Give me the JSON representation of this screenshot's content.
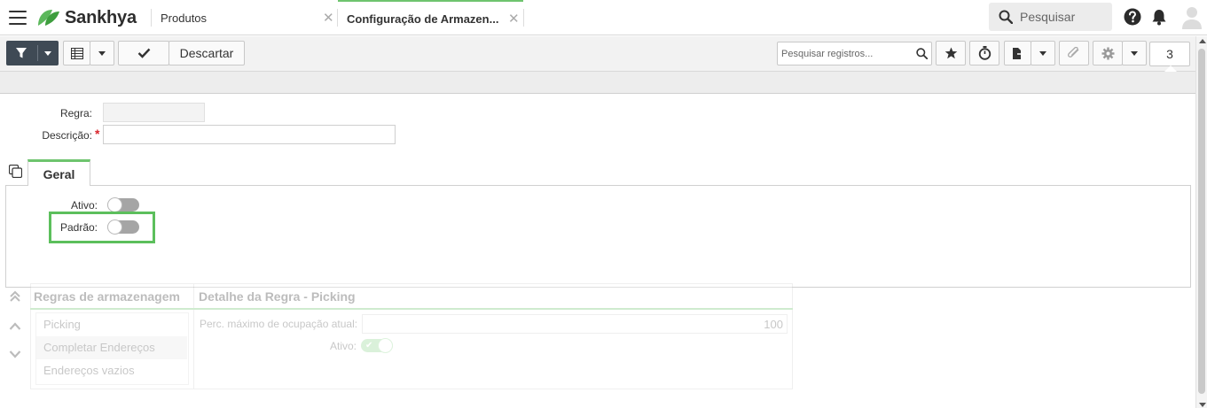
{
  "topbar": {
    "brand": "Sankhya",
    "tabs": [
      {
        "label": "Produtos",
        "close": "✕"
      },
      {
        "label": "Configuração de Armazen...",
        "close": "✕"
      }
    ],
    "search_label": "Pesquisar",
    "icons": [
      "menu-icon",
      "help-icon",
      "bell-icon",
      "user-avatar-icon"
    ]
  },
  "toolbar": {
    "discard_label": "Descartar",
    "search_placeholder": "Pesquisar registros...",
    "record_count": "3",
    "icons": [
      "filter-icon",
      "grid-icon",
      "check-icon",
      "search-icon",
      "star-icon",
      "stopwatch-icon",
      "export-icon",
      "attachment-icon",
      "gear-icon"
    ]
  },
  "form": {
    "regra_label": "Regra:",
    "descricao_label": "Descrição:",
    "required_mark": "*",
    "regra_value": "",
    "descricao_value": ""
  },
  "tabs": {
    "geral_label": "Geral"
  },
  "geral": {
    "ativo_label": "Ativo:",
    "ativo_on": false,
    "padrao_label": "Padrão:",
    "padrao_on": false
  },
  "lower": {
    "list_title": "Regras de armazenagem",
    "list_items": [
      "Picking",
      "Completar Endereços",
      "Endereços vazios"
    ],
    "selected_index": 1,
    "detail_title": "Detalhe da Regra - Picking",
    "perc_label": "Perc. máximo de ocupação atual:",
    "perc_value": "100",
    "ativo_label": "Ativo:",
    "ativo_on": true
  },
  "colors": {
    "accent_green": "#6ec46e",
    "highlight_green": "#5cbf5c",
    "filter_button": "#3f4a55",
    "required_red": "#d9262c"
  }
}
